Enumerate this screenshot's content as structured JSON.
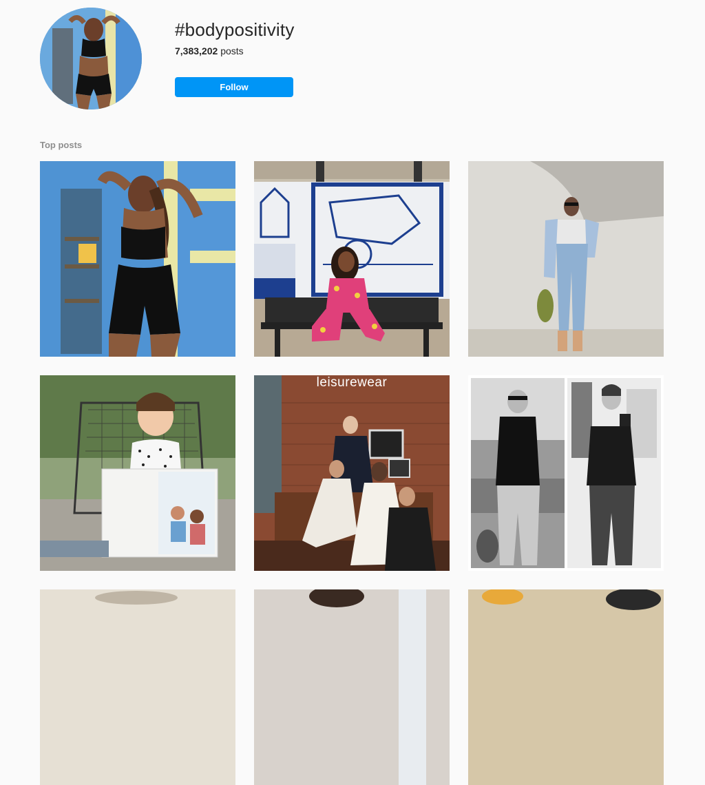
{
  "header": {
    "hashtag": "#bodypositivity",
    "post_count": "7,383,202",
    "post_count_suffix": "posts",
    "follow_label": "Follow"
  },
  "section": {
    "top_posts_label": "Top posts"
  },
  "posts": [
    {
      "overlay_text": ""
    },
    {
      "overlay_text": ""
    },
    {
      "overlay_text": ""
    },
    {
      "overlay_text": ""
    },
    {
      "overlay_text": "leisurewear"
    },
    {
      "overlay_text": ""
    },
    {
      "overlay_text": ""
    },
    {
      "overlay_text": ""
    },
    {
      "overlay_text": ""
    }
  ],
  "colors": {
    "accent": "#0095f6",
    "background": "#fafafa"
  }
}
